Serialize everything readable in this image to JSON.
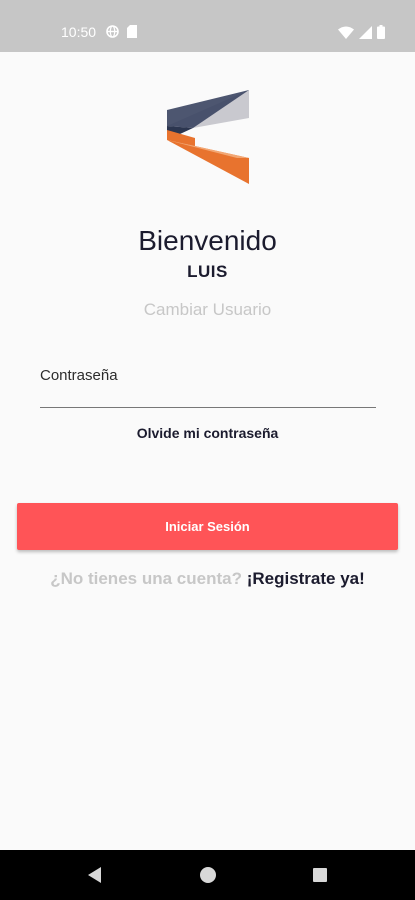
{
  "status_bar": {
    "time": "10:50",
    "left_icons": [
      "vpn-globe-icon",
      "sd-card-icon"
    ],
    "right_icons": [
      "wifi-icon",
      "signal-icon",
      "battery-icon"
    ]
  },
  "logo": {
    "name": "app-logo",
    "colors": {
      "navy": "#2c3650",
      "gray": "#c9c9cf",
      "orange": "#e8732e",
      "light_orange": "#f2a774"
    }
  },
  "welcome": {
    "title": "Bienvenido",
    "username": "LUIS",
    "change_user": "Cambiar Usuario"
  },
  "password": {
    "label": "Contraseña",
    "value": ""
  },
  "forgot_password": "Olvide mi contraseña",
  "login_button": {
    "label": "Iniciar Sesión",
    "color": "#ff5457"
  },
  "register": {
    "prompt": "¿No tienes una cuenta?",
    "link": "¡Registrate ya!"
  },
  "navigation": {
    "buttons": [
      "back-icon",
      "home-icon",
      "recents-icon"
    ]
  }
}
